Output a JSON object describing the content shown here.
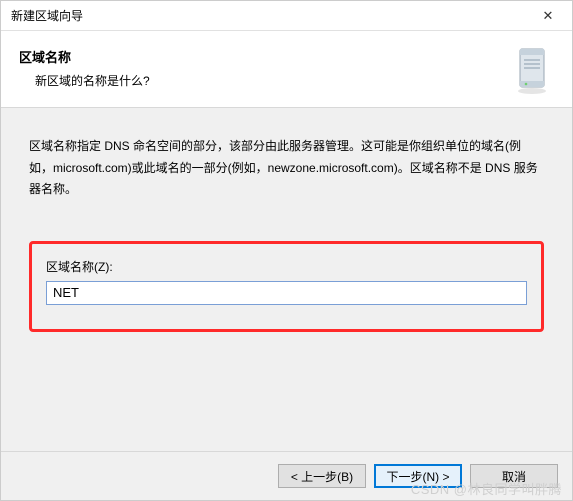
{
  "titlebar": {
    "title": "新建区域向导"
  },
  "header": {
    "title": "区域名称",
    "subtitle": "新区域的名称是什么?"
  },
  "body": {
    "description": "区域名称指定 DNS 命名空间的部分，该部分由此服务器管理。这可能是你组织单位的域名(例如，microsoft.com)或此域名的一部分(例如，newzone.microsoft.com)。区域名称不是 DNS 服务器名称。"
  },
  "field": {
    "label": "区域名称(Z):",
    "value": "NET"
  },
  "buttons": {
    "back": "< 上一步(B)",
    "next": "下一步(N) >",
    "cancel": "取消"
  },
  "watermark": "CSDN @林良同学叫胖腾"
}
